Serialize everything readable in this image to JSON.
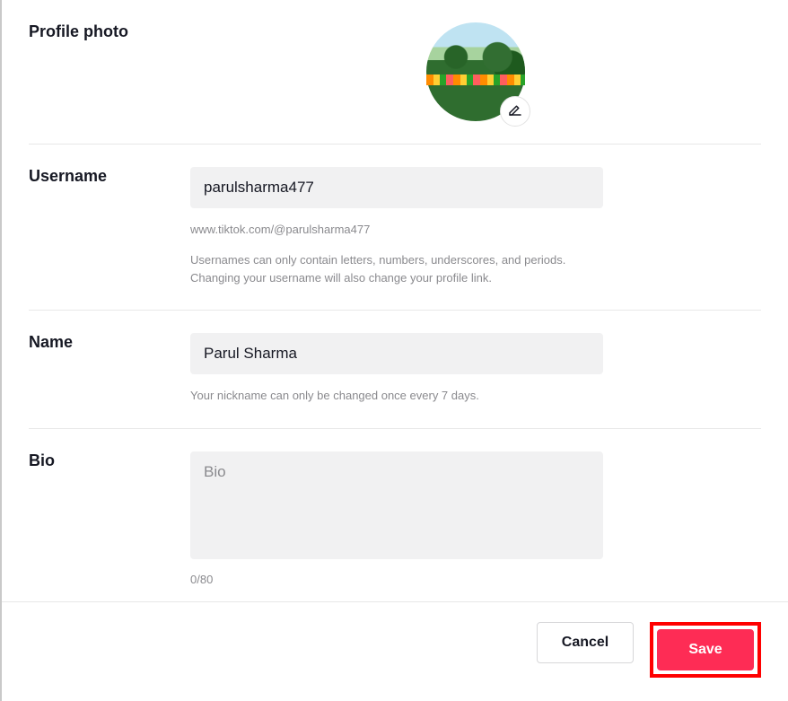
{
  "labels": {
    "profile_photo": "Profile photo",
    "username": "Username",
    "name": "Name",
    "bio": "Bio"
  },
  "username": {
    "value": "parulsharma477",
    "url": "www.tiktok.com/@parulsharma477",
    "hint": "Usernames can only contain letters, numbers, underscores, and periods. Changing your username will also change your profile link."
  },
  "name": {
    "value": "Parul Sharma",
    "hint": "Your nickname can only be changed once every 7 days."
  },
  "bio": {
    "value": "",
    "placeholder": "Bio",
    "counter": "0/80"
  },
  "buttons": {
    "cancel": "Cancel",
    "save": "Save"
  }
}
